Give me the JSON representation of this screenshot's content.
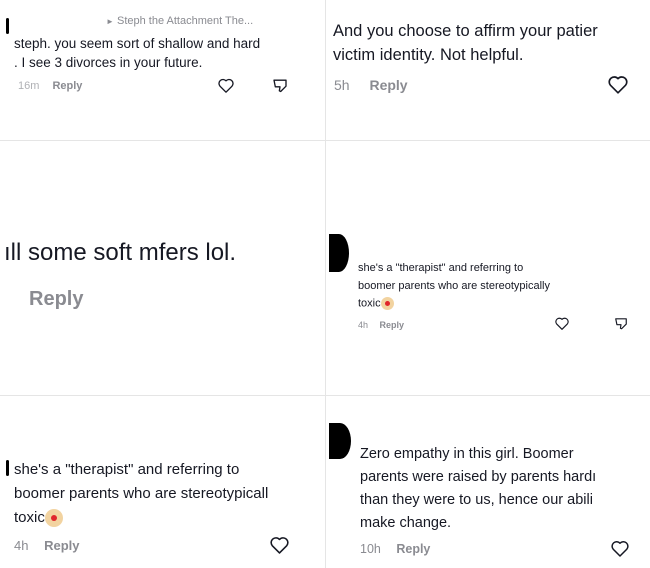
{
  "p1": {
    "replying_to": "Steph the Attachment The...",
    "line1": "steph. you seem sort of shallow and hard",
    "line2": ". I see 3 divorces in your future.",
    "time": "16m",
    "reply": "Reply"
  },
  "p2": {
    "line1": "And you choose to affirm your patier",
    "line2": "victim identity. Not helpful.",
    "time": "5h",
    "reply": "Reply"
  },
  "p3": {
    "line1": "ıll some soft mfers lol.",
    "reply": "Reply"
  },
  "p4": {
    "line1": "she's a \"therapist\" and referring to",
    "line2": "boomer parents who are stereotypically",
    "line3": "toxic",
    "time": "4h",
    "reply": "Reply"
  },
  "p5": {
    "line1": "she's a \"therapist\" and referring to",
    "line2": "boomer parents who are stereotypicall",
    "line3": "toxic",
    "time": "4h",
    "reply": "Reply"
  },
  "p6": {
    "line1": "Zero empathy in this girl. Boomer",
    "line2": "parents were raised by parents hardı",
    "line3": "than they were to us, hence our abili",
    "line4": "make change.",
    "time": "10h",
    "reply": "Reply"
  },
  "icons": [
    "heart-icon",
    "dislike-icon",
    "clown-emoji-icon",
    "play-arrow-icon"
  ]
}
